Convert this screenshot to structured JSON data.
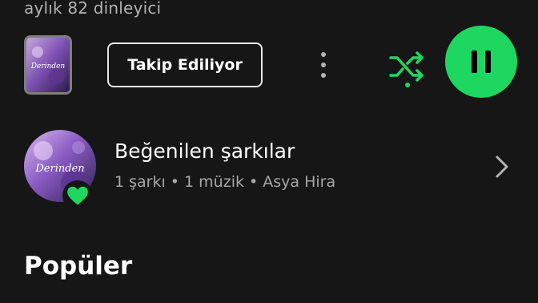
{
  "artist": {
    "monthly_listeners": "aylık 82 dinleyici"
  },
  "controls": {
    "follow_label": "Takip Ediliyor",
    "more_icon": "more-vertical-icon",
    "shuffle_icon": "shuffle-icon",
    "play_state_icon": "pause-icon",
    "accent_color": "#1ed760"
  },
  "liked_songs": {
    "title": "Beğenilen şarkılar",
    "subtitle": "1 şarkı • 1 müzik • Asya Hira",
    "art_text": "Derinden",
    "badge_icon": "heart-icon"
  },
  "thumb": {
    "art_text": "Derinden"
  },
  "section": {
    "title": "Popüler"
  }
}
